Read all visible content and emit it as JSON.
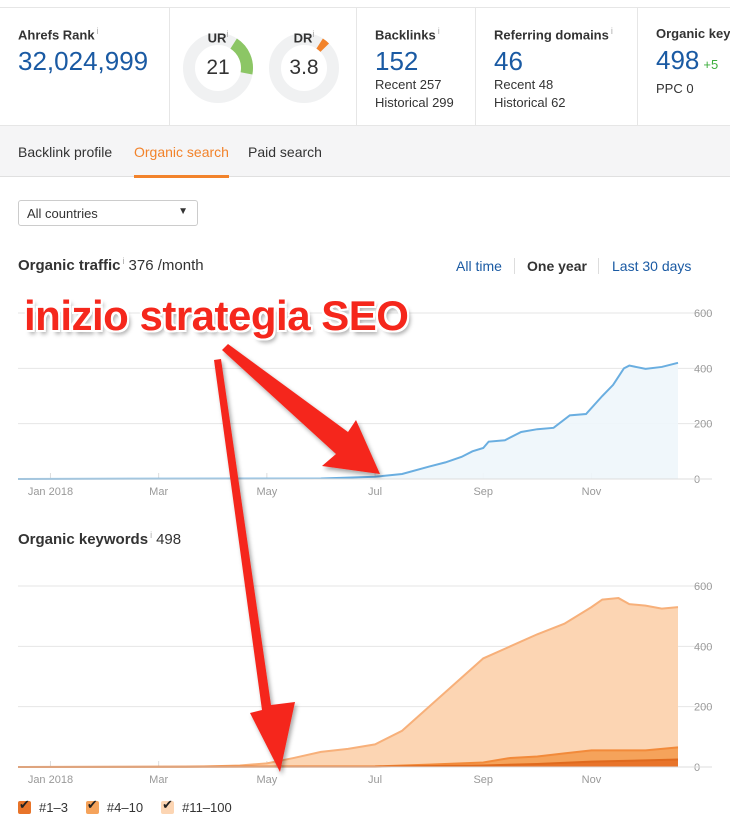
{
  "metrics": {
    "ahrefs_rank": {
      "label": "Ahrefs Rank",
      "value": "32,024,999"
    },
    "ur": {
      "label": "UR",
      "value": "21",
      "score": 21,
      "color": "#8cc665"
    },
    "dr": {
      "label": "DR",
      "value": "3.8",
      "score": 3.8,
      "color": "#f2832b"
    },
    "backlinks": {
      "label": "Backlinks",
      "value": "152",
      "recent": "Recent 257",
      "historical": "Historical 299"
    },
    "referring_domains": {
      "label": "Referring domains",
      "value": "46",
      "recent": "Recent 48",
      "historical": "Historical 62"
    },
    "organic_keywords": {
      "label": "Organic keyw",
      "value": "498",
      "delta": "+5",
      "ppc": "PPC 0"
    },
    "info_glyph": "i"
  },
  "tabs": [
    {
      "label": "Backlink profile",
      "active": false
    },
    {
      "label": "Organic search",
      "active": true
    },
    {
      "label": "Paid search",
      "active": false
    }
  ],
  "country_select": {
    "value": "All countries",
    "arrow": "▼"
  },
  "traffic": {
    "title": "Organic traffic",
    "value": "376 /month"
  },
  "ranges": [
    {
      "label": "All time",
      "selected": false
    },
    {
      "label": "One year",
      "selected": true
    },
    {
      "label": "Last 30 days",
      "selected": false
    }
  ],
  "keywords": {
    "title": "Organic keywords",
    "value": "498"
  },
  "annotation": {
    "text": "inizio strategia SEO",
    "color": "#f5271c"
  },
  "legend": [
    {
      "label": "#1–3",
      "color": "#e8742a"
    },
    {
      "label": "#4–10",
      "color": "#f5a35b"
    },
    {
      "label": "#11–100",
      "color": "#fcd5b3"
    }
  ],
  "chart_data": [
    {
      "type": "area",
      "title": "Organic traffic",
      "x_tick_labels": [
        "Jan 2018",
        "Mar",
        "May",
        "Jul",
        "Sep",
        "Nov"
      ],
      "y_tick_labels": [
        "0",
        "200",
        "400",
        "600"
      ],
      "ylim": [
        0,
        600
      ],
      "x_range_months": [
        -0.6,
        11.6
      ],
      "grid": true,
      "color": "#6aaee0",
      "series": [
        {
          "name": "Organic traffic",
          "x": [
            -0.6,
            5.0,
            5.5,
            6.0,
            6.5,
            7.0,
            7.3,
            7.6,
            7.8,
            8.0,
            8.1,
            8.4,
            8.7,
            9.0,
            9.3,
            9.6,
            9.9,
            10.2,
            10.4,
            10.6,
            10.7,
            11.0,
            11.3,
            11.6
          ],
          "values": [
            0,
            2,
            5,
            8,
            18,
            45,
            60,
            80,
            100,
            112,
            135,
            140,
            170,
            180,
            185,
            230,
            235,
            300,
            340,
            400,
            410,
            398,
            405,
            420
          ]
        }
      ]
    },
    {
      "type": "area",
      "title": "Organic keywords",
      "x_tick_labels": [
        "Jan 2018",
        "Mar",
        "May",
        "Jul",
        "Sep",
        "Nov"
      ],
      "y_tick_labels": [
        "0",
        "200",
        "400",
        "600"
      ],
      "ylim": [
        0,
        600
      ],
      "x_range_months": [
        -0.6,
        11.6
      ],
      "grid": true,
      "stacked": true,
      "series": [
        {
          "name": "#11–100",
          "color": "#fcd5b3",
          "x": [
            -0.6,
            2.5,
            3.5,
            4.0,
            4.5,
            5.0,
            5.5,
            6.0,
            6.5,
            7.0,
            7.5,
            8.0,
            8.5,
            9.0,
            9.5,
            10.0,
            10.2,
            10.5,
            10.7,
            11.0,
            11.3,
            11.6
          ],
          "values": [
            0,
            0,
            5,
            12,
            30,
            50,
            60,
            75,
            120,
            200,
            280,
            360,
            400,
            440,
            475,
            530,
            555,
            560,
            540,
            535,
            525,
            530
          ]
        },
        {
          "name": "#4–10",
          "color": "#f5a35b",
          "x": [
            -0.6,
            6.0,
            7.0,
            8.0,
            8.5,
            9.0,
            9.5,
            10.0,
            10.5,
            11.0,
            11.6
          ],
          "values": [
            0,
            2,
            8,
            15,
            30,
            35,
            45,
            55,
            55,
            55,
            65
          ]
        },
        {
          "name": "#1–3",
          "color": "#e8742a",
          "x": [
            -0.6,
            6.0,
            8.0,
            9.0,
            10.0,
            10.5,
            11.0,
            11.6
          ],
          "values": [
            0,
            1,
            5,
            10,
            18,
            20,
            22,
            25
          ]
        }
      ]
    }
  ]
}
